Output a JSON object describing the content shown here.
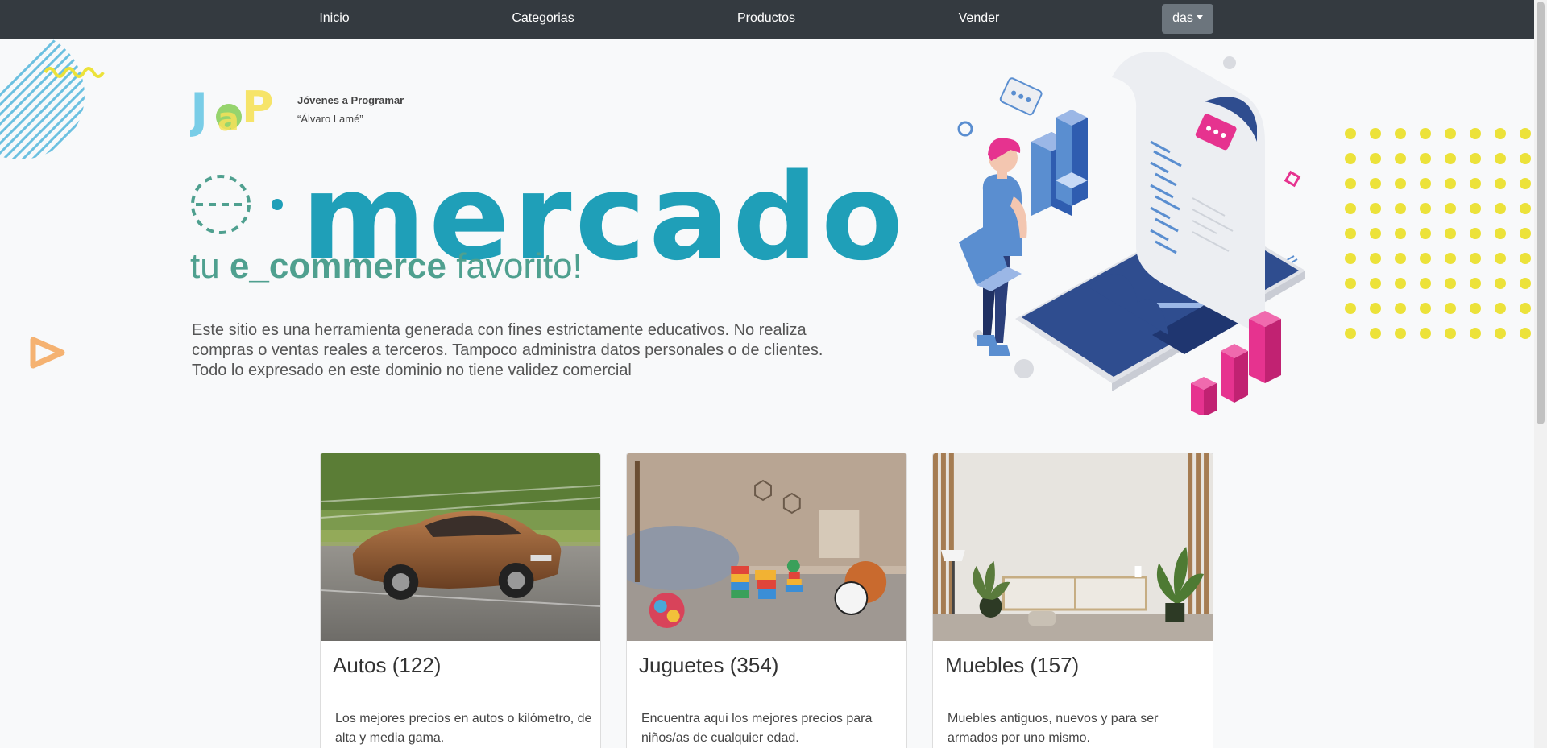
{
  "nav": {
    "items": [
      {
        "label": "Inicio"
      },
      {
        "label": "Categorias"
      },
      {
        "label": "Productos"
      },
      {
        "label": "Vender"
      }
    ],
    "user_label": "das"
  },
  "hero": {
    "org_name": "Jóvenes a Programar",
    "org_subtitle": "“Álvaro Lamé”",
    "brand_word": "mercado",
    "tagline_prefix": "tu ",
    "tagline_bold": "e_commerce",
    "tagline_suffix": " favorito!",
    "disclaimer": "Este sitio  es una herramienta generada con fines estrictamente educativos. No realiza compras o ventas reales a terceros. Tampoco administra datos personales o de clientes. Todo lo expresado en este dominio no tiene validez comercial"
  },
  "categories": [
    {
      "title": "Autos (122)",
      "description": "Los mejores precios en autos o kilómetro, de alta y media gama."
    },
    {
      "title": "Juguetes (354)",
      "description": "Encuentra aqui los mejores precios para niños/as de cualquier edad."
    },
    {
      "title": "Muebles (157)",
      "description": "Muebles antiguos, nuevos y para ser armados por uno mismo."
    }
  ],
  "colors": {
    "navbar": "#343a40",
    "brand": "#1f9fb8",
    "tagline": "#4fa08f",
    "accent_pink": "#e6338f",
    "accent_yellow": "#ece23a"
  }
}
